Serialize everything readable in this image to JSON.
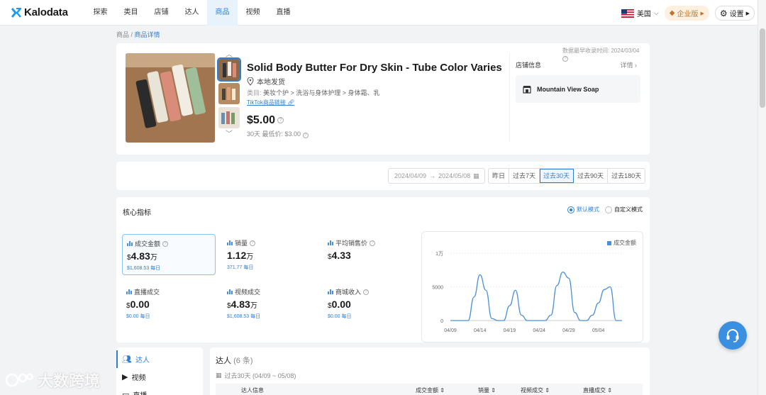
{
  "brand": {
    "name": "Kalodata"
  },
  "nav": {
    "items": [
      "探索",
      "类目",
      "店铺",
      "达人",
      "商品",
      "视频",
      "直播"
    ],
    "active_index": 4
  },
  "region": {
    "label": "美国"
  },
  "enterprise_label": "企业版",
  "settings_label": "设置",
  "breadcrumb": {
    "root": "商品",
    "sep": " / ",
    "current": "商品详情"
  },
  "product": {
    "title": "Solid Body Butter For Dry Skin - Tube Color Varies",
    "shipping": "本地发货",
    "category_label": "类目: ",
    "category": "美妆个护 > 洗浴与身体护理 > 身体霜、乳",
    "tiktok_link": "TikTok商品链接",
    "price": "$5.00",
    "low_price_text": "30天 最低价: $3.00"
  },
  "shop": {
    "header": "店铺信息",
    "more": "详情",
    "name": "Mountain View Soap"
  },
  "data_time": "数据最早收录时间: 2024/03/04",
  "date_range": {
    "start": "2024/04/09",
    "arrow": "→",
    "end": "2024/05/08"
  },
  "periods": [
    "昨日",
    "过去7天",
    "过去30天",
    "过去90天",
    "过去180天"
  ],
  "active_period": 2,
  "core": {
    "title": "核心指标",
    "mode_default": "默认模式",
    "mode_custom": "自定义模式",
    "metrics": [
      {
        "label": "成交金额",
        "currency": "$",
        "value": "4.83",
        "unit": "万",
        "sub": "$1,608.53 每日",
        "info": true,
        "selected": true
      },
      {
        "label": "销量",
        "currency": "",
        "value": "1.12",
        "unit": "万",
        "sub": "371.77 每日",
        "info": true
      },
      {
        "label": "平均销售价",
        "currency": "$",
        "value": "4.33",
        "unit": "",
        "sub": "",
        "info": true
      },
      {
        "label": "直播成交",
        "currency": "$",
        "value": "0.00",
        "unit": "",
        "sub": "$0.00 每日",
        "info": false
      },
      {
        "label": "视频成交",
        "currency": "$",
        "value": "4.83",
        "unit": "万",
        "sub": "$1,608.53 每日",
        "info": false
      },
      {
        "label": "商城收入",
        "currency": "$",
        "value": "0.00",
        "unit": "",
        "sub": "$0.00 每日",
        "info": true
      }
    ]
  },
  "chart_data": {
    "type": "line",
    "series": [
      {
        "name": "成交金额",
        "color": "#4a90d9",
        "values": [
          0,
          0,
          0,
          0,
          3500,
          6800,
          4500,
          300,
          0,
          0,
          2200,
          4500,
          800,
          0,
          0,
          0,
          0,
          800,
          5200,
          7200,
          6300,
          1200,
          0,
          0,
          800,
          2600,
          4600,
          5000,
          0,
          0
        ]
      }
    ],
    "x": [
      "04/09",
      "04/10",
      "04/11",
      "04/12",
      "04/13",
      "04/14",
      "04/15",
      "04/16",
      "04/17",
      "04/18",
      "04/19",
      "04/20",
      "04/21",
      "04/22",
      "04/23",
      "04/24",
      "04/25",
      "04/26",
      "04/27",
      "04/28",
      "04/29",
      "04/30",
      "05/01",
      "05/02",
      "05/03",
      "05/04",
      "05/05",
      "05/06",
      "05/07",
      "05/08"
    ],
    "x_ticks": [
      "04/09",
      "04/14",
      "04/19",
      "04/24",
      "04/29",
      "05/04"
    ],
    "y_ticks": [
      "0",
      "5000",
      "1万"
    ],
    "ylim": [
      0,
      10000
    ],
    "grid": true,
    "legend": "top-right"
  },
  "sidebar": {
    "items": [
      "达人",
      "视频",
      "直播"
    ],
    "active_index": 0
  },
  "influencers": {
    "title": "达人",
    "count": "(6 条)",
    "range": "过去30天 (04/09 ~ 05/08)",
    "columns": [
      "达人信息",
      "成交金额 ⇕",
      "销量 ⇕",
      "视频成交 ⇕",
      "直播成交 ⇕"
    ]
  },
  "watermark": "大数跨境"
}
